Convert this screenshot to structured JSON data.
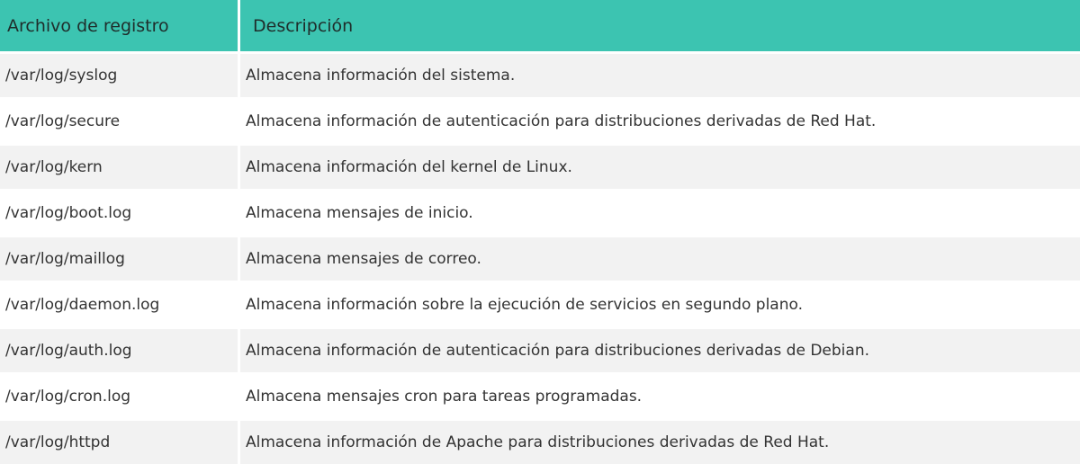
{
  "header": {
    "file_label": "Archivo de registro",
    "description_label": "Descripción"
  },
  "rows": [
    {
      "file": "/var/log/syslog",
      "description": "Almacena información del sistema."
    },
    {
      "file": "/var/log/secure",
      "description": "Almacena información de autenticación para distribuciones derivadas de Red Hat."
    },
    {
      "file": "/var/log/kern",
      "description": "Almacena información del kernel de Linux."
    },
    {
      "file": "/var/log/boot.log",
      "description": "Almacena mensajes de inicio."
    },
    {
      "file": "/var/log/maillog",
      "description": "Almacena mensajes de correo."
    },
    {
      "file": "/var/log/daemon.log",
      "description": "Almacena información sobre la ejecución de servicios en segundo plano."
    },
    {
      "file": "/var/log/auth.log",
      "description": "Almacena información de autenticación para distribuciones derivadas de Debian."
    },
    {
      "file": "/var/log/cron.log",
      "description": "Almacena mensajes cron para tareas programadas."
    },
    {
      "file": "/var/log/httpd",
      "description": "Almacena información de Apache para distribuciones derivadas de Red Hat."
    }
  ],
  "colors": {
    "header_bg": "#3cc4b1",
    "row_alt_bg": "#f2f2f2"
  }
}
